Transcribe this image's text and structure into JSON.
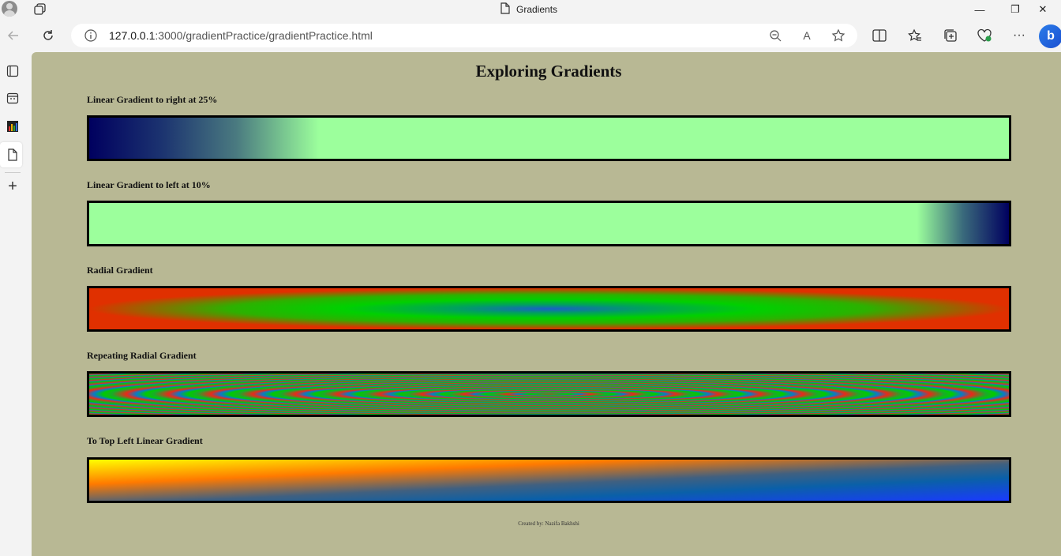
{
  "window": {
    "title": "Gradients",
    "controls": {
      "minimize": "—",
      "restore": "❐",
      "close": "✕"
    }
  },
  "navbar": {
    "url_host": "127.0.0.1",
    "url_rest": ":3000/gradientPractice/gradientPractice.html",
    "icons": [
      "back-icon",
      "refresh-icon",
      "info-icon",
      "zoom-out-icon",
      "read-aloud-icon",
      "favorite-icon",
      "split-screen-icon",
      "favorites-icon",
      "collections-icon",
      "browser-essentials-icon",
      "more-icon",
      "copilot-icon"
    ],
    "read_aloud": "A",
    "more": "···",
    "copilot": "b"
  },
  "sidebar": {
    "icons": [
      "vertical-tabs-icon",
      "calendar-icon",
      "chart-icon",
      "page-icon",
      "add-icon"
    ],
    "add": "+"
  },
  "page": {
    "title": "Exploring Gradients",
    "sections": [
      {
        "label": "Linear Gradient to right at 25%"
      },
      {
        "label": "Linear Gradient to left at 10%"
      },
      {
        "label": "Radial Gradient"
      },
      {
        "label": "Repeating Radial Gradient"
      },
      {
        "label": "To Top Left Linear Gradient"
      }
    ],
    "footer": "Created by: Nazifa Bakhshi",
    "colors": {
      "background": "#b8b894",
      "light_green": "#9cff9c",
      "navy": "#00005f",
      "border": "#000000"
    }
  }
}
